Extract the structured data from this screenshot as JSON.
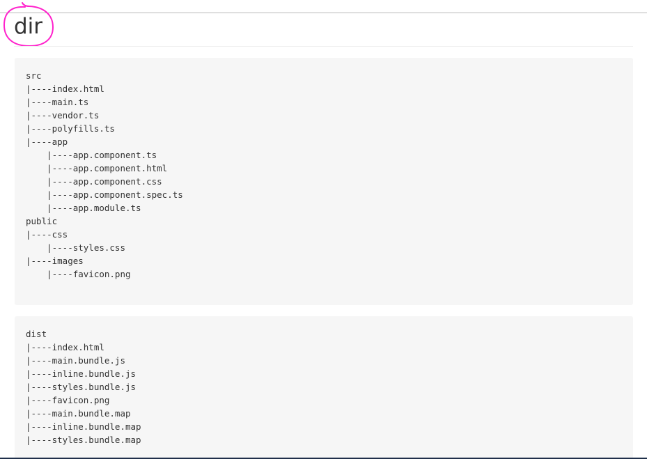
{
  "heading": "dir",
  "annotation": {
    "circle_color": "#ff22cc"
  },
  "source_tree": [
    "src",
    "|----index.html",
    "|----main.ts",
    "|----vendor.ts",
    "|----polyfills.ts",
    "|----app",
    "    |----app.component.ts",
    "    |----app.component.html",
    "    |----app.component.css",
    "    |----app.component.spec.ts",
    "    |----app.module.ts",
    "public",
    "|----css",
    "    |----styles.css",
    "|----images",
    "    |----favicon.png"
  ],
  "dist_tree": [
    "dist",
    "|----index.html",
    "|----main.bundle.js",
    "|----inline.bundle.js",
    "|----styles.bundle.js",
    "|----favicon.png",
    "|----main.bundle.map",
    "|----inline.bundle.map",
    "|----styles.bundle.map"
  ]
}
